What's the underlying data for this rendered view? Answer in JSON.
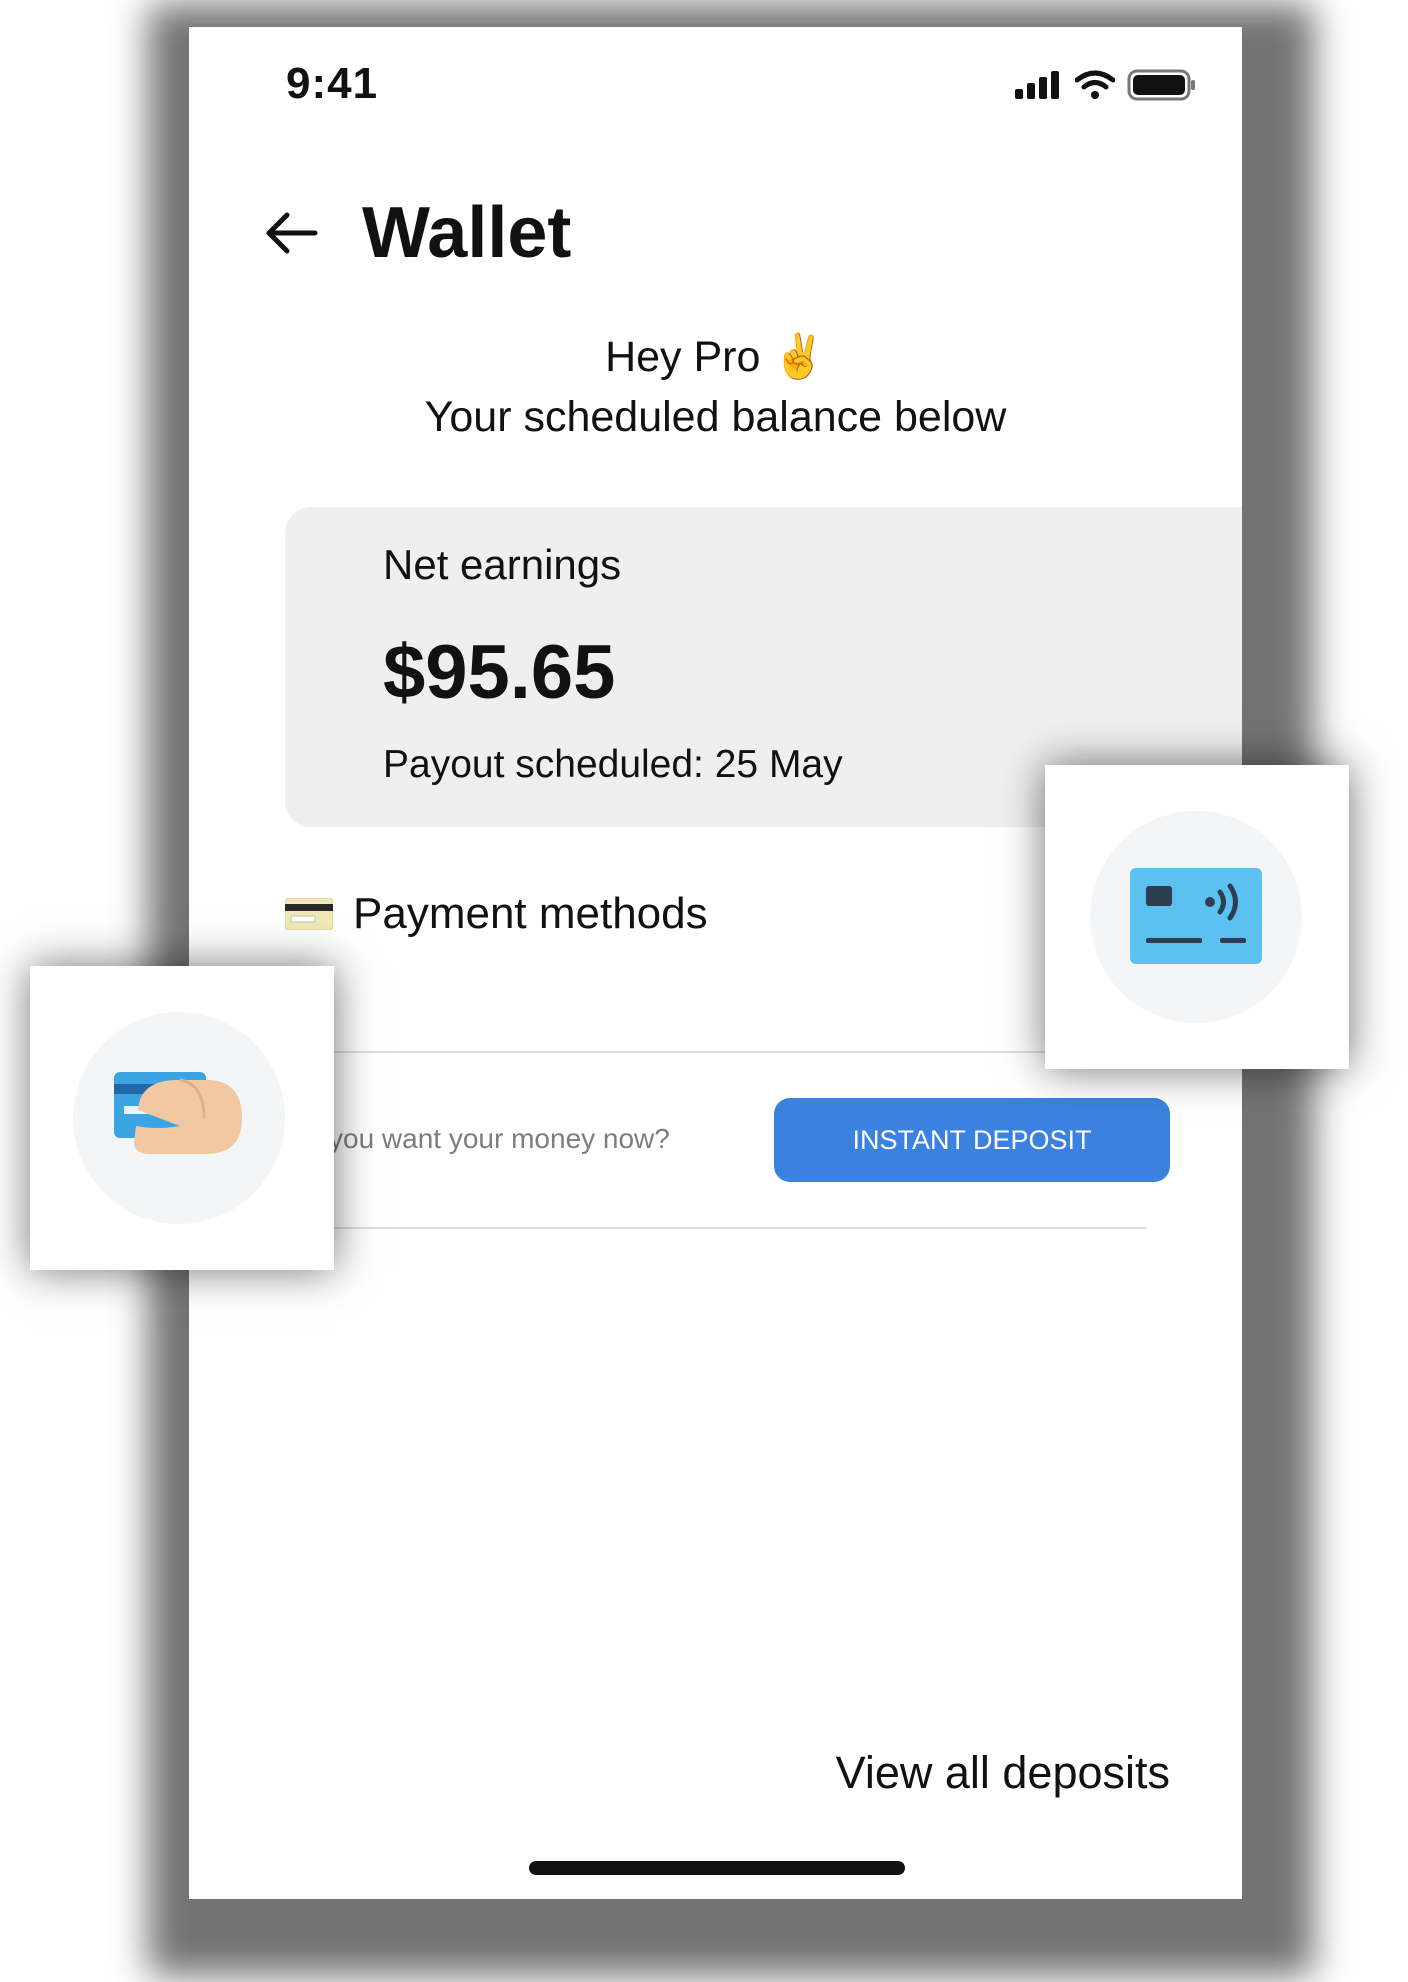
{
  "status_bar": {
    "time": "9:41"
  },
  "header": {
    "title": "Wallet"
  },
  "greeting": {
    "line1": "Hey Pro ✌️",
    "line2": "Your scheduled balance below"
  },
  "earnings": {
    "label": "Net earnings",
    "amount": "$95.65",
    "payout": "Payout scheduled: 25 May"
  },
  "payment_methods": {
    "label": "Payment methods"
  },
  "instant": {
    "question": "you want your money now?",
    "button_label": "INSTANT DEPOSIT"
  },
  "footer": {
    "view_all": "View all deposits"
  },
  "colors": {
    "accent": "#3b82e0",
    "card_bg": "#efefef",
    "card_icon": "#5cc1f0"
  }
}
